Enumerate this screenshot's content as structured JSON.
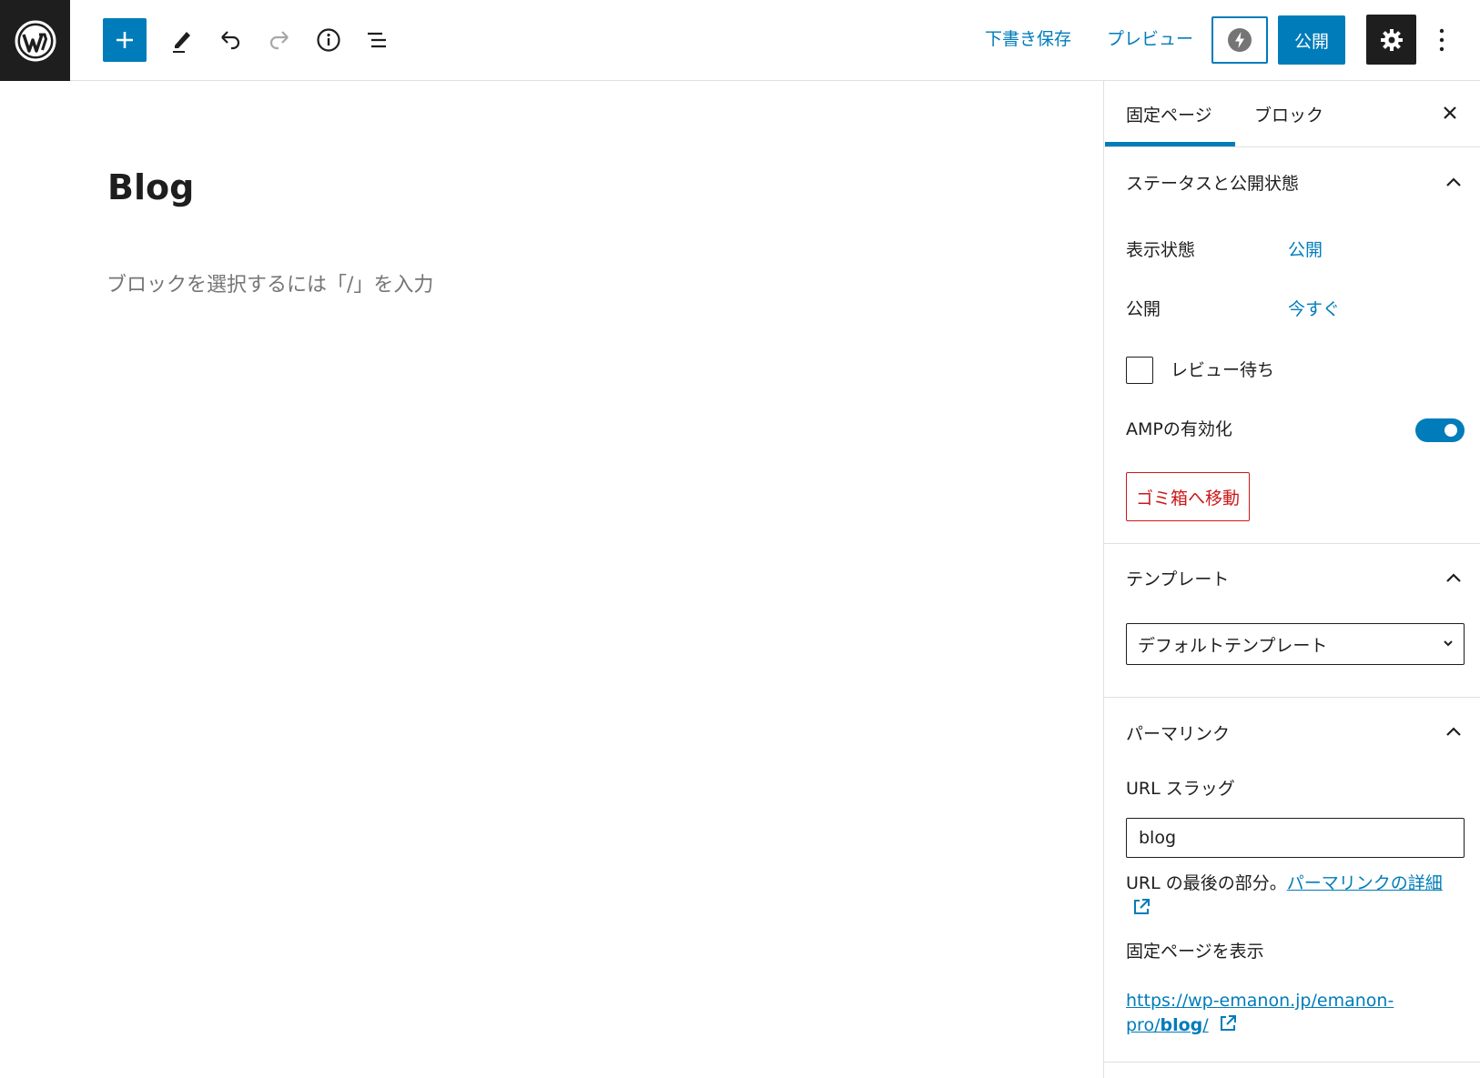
{
  "toolbar": {
    "save_draft": "下書き保存",
    "preview": "プレビュー",
    "publish": "公開"
  },
  "editor": {
    "title": "Blog",
    "placeholder": "ブロックを選択するには「/」を入力"
  },
  "sidebar": {
    "tabs": [
      {
        "label": "固定ページ"
      },
      {
        "label": "ブロック"
      }
    ],
    "status_panel": {
      "title": "ステータスと公開状態",
      "visibility_label": "表示状態",
      "visibility_value": "公開",
      "publish_label": "公開",
      "publish_value": "今すぐ",
      "pending_review": "レビュー待ち",
      "amp_label": "AMPの有効化",
      "amp_enabled": true,
      "trash": "ゴミ箱へ移動"
    },
    "template_panel": {
      "title": "テンプレート",
      "selected": "デフォルトテンプレート"
    },
    "permalink_panel": {
      "title": "パーマリンク",
      "slug_label": "URL スラッグ",
      "slug_value": "blog",
      "help_text": "URL の最後の部分。",
      "help_link": "パーマリンクの詳細",
      "view_label": "固定ページを表示",
      "url_prefix": "https://wp-emanon.jp/emanon-pro/",
      "url_slug": "blog",
      "url_suffix": "/"
    }
  },
  "colors": {
    "accent": "#007cba",
    "dark": "#1e1e1e",
    "danger": "#cc1818"
  }
}
